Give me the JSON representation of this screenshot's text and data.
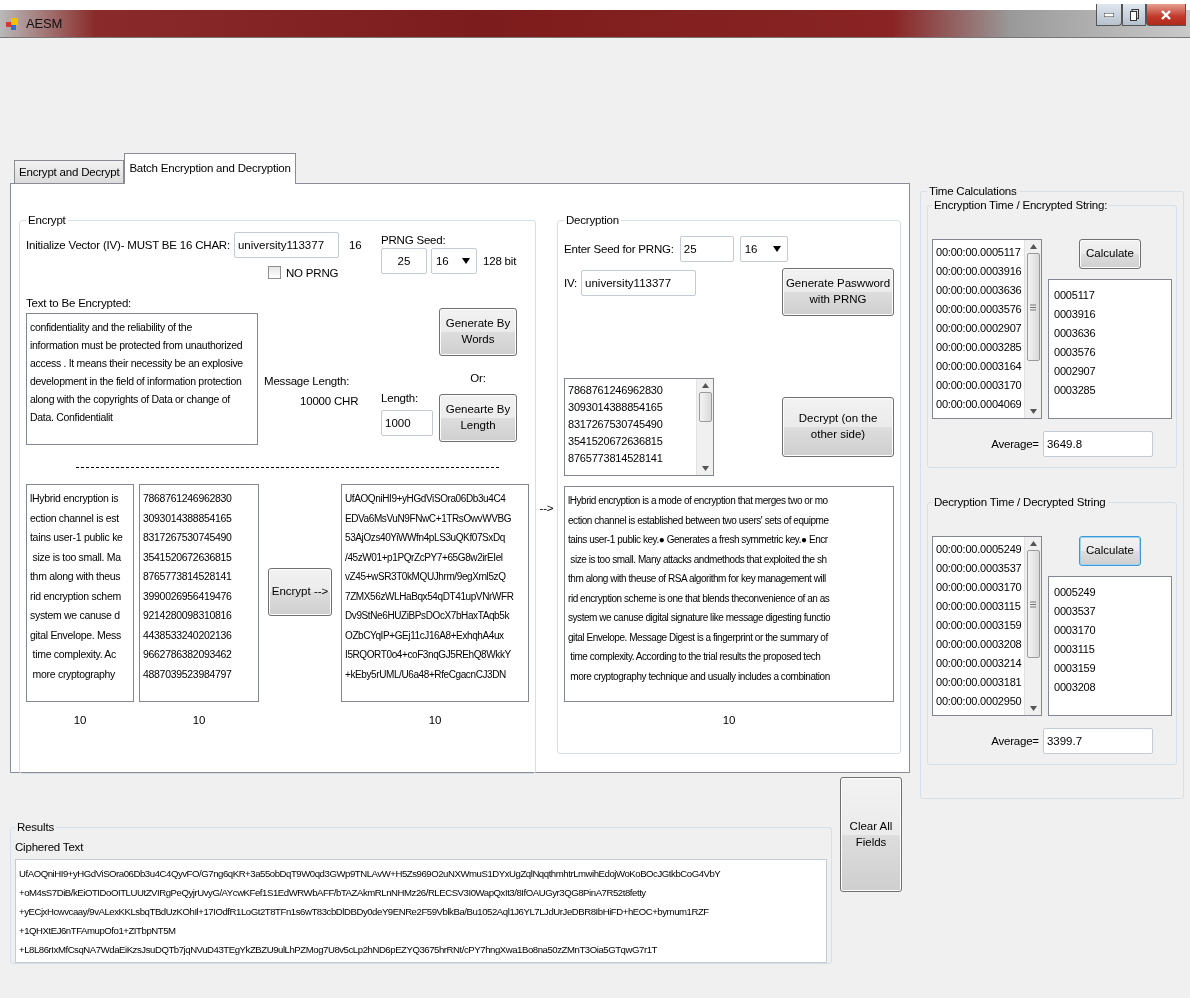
{
  "window": {
    "title": "AESM"
  },
  "tabs": [
    {
      "label": "Encrypt and Decrypt",
      "selected": false
    },
    {
      "label": "Batch Encryption and Decryption",
      "selected": true
    }
  ],
  "encrypt": {
    "title": "Encrypt",
    "iv_label": "Initialize Vector (IV)- MUST BE 16 CHAR:",
    "iv_value": "university113377",
    "iv_count": "16",
    "no_prng": {
      "label": "NO PRNG",
      "checked": false
    },
    "seed_label": "PRNG Seed:",
    "seed": "25",
    "key_size": "16",
    "key_bits": "128 bit",
    "text_label": "Text to Be Encrypted:",
    "text": [
      "confidentiality and the reliability of the",
      "information must be protected from unauthorized",
      "access . It means their necessity be an explosive",
      "development in the field of information protection",
      "along with the copyrights of Data or change of",
      "Data. Confidentialit"
    ],
    "message_length_label": "Message Length:",
    "message_length": "10000  CHR",
    "generate_words_button": "Generate By Words",
    "or_label": "Or:",
    "length_label": "Length:",
    "length": "1000",
    "generate_length_button": "Genearte By Length",
    "plain_lines": [
      "lHybrid encryption is",
      "ection channel is est",
      "tains user-1 public ke",
      " size is too small. Ma",
      "thm along with theus",
      "rid encryption schem",
      "system we canuse d",
      "gital Envelope. Mess",
      " time complexity. Ac",
      " more cryptography"
    ],
    "plain_count": "10",
    "key_lines": [
      "7868761246962830",
      "3093014388854165",
      "8317267530745490",
      "3541520672636815",
      "8765773814528141",
      "3990026956419476",
      "9214280098310816",
      "4438533240202136",
      "9662786382093462",
      "4887039523984797"
    ],
    "key_count": "10",
    "encrypt_button": "Encrypt -->",
    "cipher_lines": [
      "UfAOQniHI9+yHGdViSOra06Db3u4C4",
      "EDVa6MsVuN9FNwC+1TRsOwvWVBG",
      "53AjOzs40YiWWfn4pLS3uQKf07SxDq",
      "/45zW01+p1PQrZcPY7+65G8w2irEIel",
      "vZ45+wSR3T0kMQUJhrm/9egXrnl5zQ",
      "7ZMX56zWLHaBqx54qDT41upVNrWFR",
      "Dv9StNe6HUZiBPsDOcX7bHaxTAqb5k",
      "OZbCYqIP+GEj11cJ16A8+ExhqhA4ux",
      "I5RQORT0o4+coF3nqGJ5REhQ8WkkY",
      "+kEby5rUML/U6a48+RfeCgacnCJ3DN"
    ],
    "cipher_count": "10"
  },
  "arrow_label": "-->",
  "decryption": {
    "title": "Decryption",
    "seed_label": "Enter Seed for PRNG:",
    "seed": "25",
    "key_size": "16",
    "iv_label": "IV:",
    "iv_value": "university113377",
    "generate_button": "Generate Paswword with PRNG",
    "key_list": [
      "7868761246962830",
      "3093014388854165",
      "8317267530745490",
      "3541520672636815",
      "8765773814528141"
    ],
    "decrypt_button": "Decrypt (on the other side)",
    "plain_lines": [
      "lHybrid encryption is a mode of encryption that merges two or mo",
      "ection channel is established between two users' sets of equipme",
      "tains user-1 public key.● Generates a fresh symmetric key.● Encr",
      " size is too small. Many attacks andmethods that exploited the sh",
      "thm along with theuse of RSA algorithm for key management will",
      "rid encryption scheme is one that blends theconvenience of an as",
      "system we canuse digital signature like message digesting functio",
      "gital Envelope. Message Digest is a fingerprint or the summary of",
      " time complexity. According to the trial results the proposed tech",
      " more cryptography technique and usually includes a combination"
    ],
    "count": "10"
  },
  "time_calculations": {
    "title": "Time Calculations",
    "groups": [
      {
        "title": "Encryption Time / Encrypted String:",
        "times": [
          "00:00:00.0005117",
          "00:00:00.0003916",
          "00:00:00.0003636",
          "00:00:00.0003576",
          "00:00:00.0002907",
          "00:00:00.0003285",
          "00:00:00.0003164",
          "00:00:00.0003170",
          "00:00:00.0004069"
        ],
        "calculate_button": {
          "label": "Calculate",
          "focused": false
        },
        "values": [
          "0005117",
          "0003916",
          "0003636",
          "0003576",
          "0002907",
          "0003285"
        ],
        "average_label": "Average=",
        "average": "3649.8"
      },
      {
        "title": "Decryption Time / Decrypted String",
        "times": [
          "00:00:00.0005249",
          "00:00:00.0003537",
          "00:00:00.0003170",
          "00:00:00.0003115",
          "00:00:00.0003159",
          "00:00:00.0003208",
          "00:00:00.0003214",
          "00:00:00.0003181",
          "00:00:00.0002950"
        ],
        "calculate_button": {
          "label": "Calculate",
          "focused": true
        },
        "values": [
          "0005249",
          "0003537",
          "0003170",
          "0003115",
          "0003159",
          "0003208"
        ],
        "average_label": "Average=",
        "average": "3399.7"
      }
    ]
  },
  "results": {
    "title": "Results",
    "ciphered_label": "Ciphered Text",
    "ciphered_lines": [
      "UfAOQniHI9+yHGdViSOra06Db3u4C4QyvFO/G7ng6qKR+3a55obDqT9W0qd3GWp9TNLAvW+H5Zs969O2uNXWmuS1DYxUgZqlNqqthmhtrLmwihEdojWoKoBOcJGtkbCoG4VbY",
      "+oM4sS7DiB/kEiOTIDoOITLUUtZVIRgPeQyjrUvyG/AYcwKFef1S1EdWRWbAFF/bTAZAkmRLnNHMz26/RLECSV3I0WapQxIt3/8IfOAUGyr3QG8PinA7R52t8fetty",
      "+yECjxHcwvcaay/9vALexKKLsbqTBdUzKOhIl+17IOdfR1LoGt2T8TFn1s6wT83cbDlDBDy0deY9ENRe2F59VblkBa/Bu1052Aql1J6YL7LJdUrJeDBR8IbHiFD+hEOC+bymum1RZF",
      "+1QHXtEJ6nTFAmupOfo1+ZITbpNT5M",
      "+L8L86rIxMfCsqNA7WdaEiKzsJsuDQTb7jqNVuD43TEgYkZBZU9ulLhPZMog7U8v5cLp2hND6pEZYQ3675hrRNt/cPY7hngXwa1Bo8na50zZMnT3Oia5GTqwG7r1T"
    ]
  },
  "clear_button": "Clear All Fields"
}
